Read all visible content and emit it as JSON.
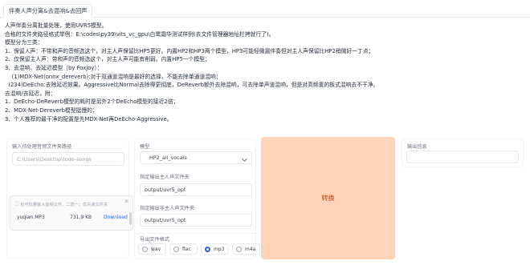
{
  "tabs": {
    "active": "伴奏人声分离&去混响&去回声"
  },
  "description": [
    "人声伴奏分离批量处理，使用UVR5模型。",
    "合格的文件夹路径格式举例：E:\\codes\\py39\\vits_vc_gpu\\白鹭霜华测试样例(去文件管理器地址栏拷就行了)。",
    "模型分为三类：",
    "1、保留人声：不带和声的音频选这个，对主人声保留比HP5更好。内置HP2和HP3两个模型，HP3可能轻微漏伴奏但对主人声保留比HP2稍微好一丁点；",
    "2、仅保留主人声：带和声的音频选这个，对主人声可能有削弱。内置HP5一个模型；",
    "3、去混响、去延迟模型（by FoxJoy）：",
    "    (1)MDX-Net(onnx_dereverb):对于双通道混响是最好的选择，不能去除单通道混响；",
    "  (234)DeEcho:去除延迟效果。Aggressive比Normal去除得更彻底，DeReverb额外去除混响，可去除单声道混响，但是对高频重的板式混响去不干净。",
    "去混响/去延迟，附：",
    "1、DeEcho-DeReverb模型的耗时是另外2个DeEcho模型的接近2倍；",
    "2、MDX-Net-Dereverb模型挺慢的；",
    "3、个人推荐的最干净的配置是先MDX-Net再DeEcho-Aggressive。"
  ],
  "input_panel": {
    "dir_label": "输入待处理音频文件夹路径",
    "dir_placeholder": "C:\\Users\\Desktop\\todo-songs",
    "file_hint": "也可批量输入音频文件，二选一，优先读文件夹",
    "file": {
      "name": "yuqian.MP3",
      "size": "731.9 KB",
      "action": "Download"
    },
    "close_icon": "close-icon",
    "hint_icon": "file-icon"
  },
  "settings_panel": {
    "model_label": "模型",
    "model_value": "HP2_all_vocals",
    "vocal_dir_label": "指定输出主人声文件夹",
    "vocal_dir_value": "output/uvr5_opt",
    "other_dir_label": "指定输出非主人声文件夹",
    "other_dir_value": "output/uvr5_opt",
    "format_label": "导出文件格式",
    "formats": [
      "wav",
      "flac",
      "mp3",
      "m4a"
    ],
    "selected_format": "mp3"
  },
  "convert_button": {
    "label": "转换",
    "color": "#fed3b7"
  },
  "output_panel": {
    "label": "输出信息",
    "value": ""
  }
}
